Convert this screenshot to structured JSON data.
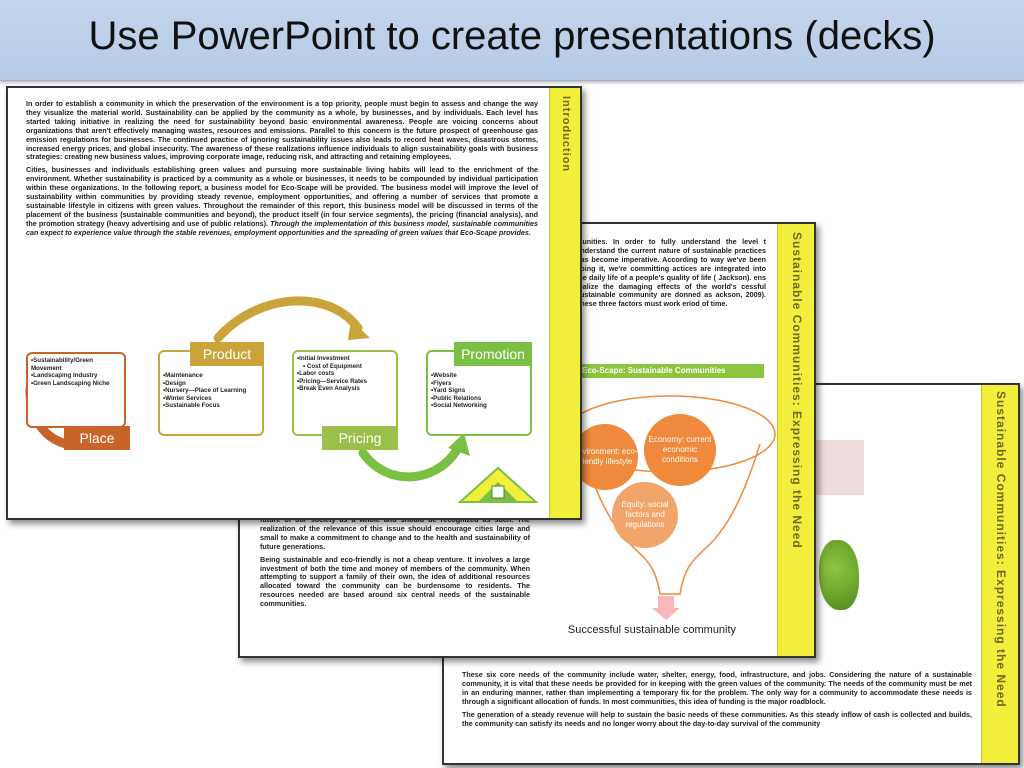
{
  "title": "Use PowerPoint to create presentations (decks)",
  "slide3": {
    "side_title": "Sustainable Communities: Expressing the Need",
    "paragraphs": [
      "These six core needs of the community include water, shelter, energy, food, infrastructure, and jobs. Considering the nature of a sustainable community, it is vital that these needs be provided for in keeping with the green values of the community. The needs of the community must be met in an enduring manner, rather than implementing a temporary fix for the problem. The only way for a community to accommodate these needs is through a significant allocation of funds. In most communities, this idea of funding is the major roadblock.",
      "The generation of a steady revenue will help to sustain the basic needs of these communities. As this steady inflow of cash is collected and builds, the community can satisfy its needs and no longer worry about the day-to-day survival of the community"
    ]
  },
  "slide2": {
    "side_title": "Sustainable Communities: Expressing the Need",
    "top_text": "munities. In order to fully understand the level t understand the current nature of sustainable practices has become imperative. According to way we've been doing it, we're committing actices are integrated into the daily life of a people's quality of life ( Jackson). ens realize the damaging effects of the world's cessful sustainable community are donned as ackson, 2009). These three factors must work eriod of time.",
    "bar_label": "Eco-Scape: Sustainable Communities",
    "circles": {
      "environment": "Environment: eco-friendly lifestyle",
      "economy": "Economy: current economic conditions",
      "equity": "Equity: social factors and regulations"
    },
    "result": "Successful sustainable community",
    "bottom_paragraphs": [
      "future of our society as a whole and should be recognized as such. The realization of the relevance of this issue should encourage cities large and small to make a commitment to change and to the health and sustainability of future generations.",
      "Being sustainable and eco-friendly is not a cheap venture. It involves a large investment of both the time and money of members of the community. When attempting to support a family of their own, the idea of additional resources allocated toward the community can be burdensome to residents. The resources needed are based around six central needs of the sustainable communities."
    ]
  },
  "slide1": {
    "side_title": "Introduction",
    "para1": "In order to establish a community in which the preservation of the environment is a top priority, people must begin to assess and change the way they visualize the material world. Sustainability can be applied by the community as a whole, by businesses, and by individuals. Each level has started taking initiative in realizing the need for sustainability beyond basic environmental awareness. People are voicing concerns about organizations that aren't effectively managing wastes, resources and emissions. Parallel to this concern is the future prospect of greenhouse gas emission regulations for businesses. The continued practice of ignoring sustainability issues also leads to record heat waves, disastrous storms, increased energy prices, and global insecurity. The awareness of these realizations influence individuals to align sustainability goals with business strategies: creating new business values, improving corporate image, reducing risk, and attracting and retaining employees.",
    "para2": "Cities, businesses and individuals establishing green values and pursuing more sustainable living habits will lead to the enrichment of the environment. Whether sustainability is practiced by a community as a whole or businesses, it needs to be compounded by individual participation within these organizations. In the following report, a business model for Eco-Scape will be provided. The business model will improve the level of sustainability within communities by providing steady revenue, employment opportunities, and offering a number of services that promote a sustainable lifestyle in citizens with green values. Throughout the remainder of this report, this business model will be discussed in terms of the placement of the business (sustainable communities and beyond), the product itself (in four service segments), the pricing (financial analysis), and the promotion strategy (heavy advertising and use of public relations).",
    "para2_italic": "Through the implementation of this business model, sustainable communities can expect to experience value through the stable revenues, employment opportunities and the spreading of green values that Eco-Scape provides.",
    "place": {
      "label": "Place",
      "items": [
        "•Sustainability/Green Movement",
        "•Landscaping Industry",
        "•Green Landscaping Niche"
      ]
    },
    "product": {
      "label": "Product",
      "items": [
        "•Maintenance",
        "•Design",
        "•Nursery—Place of Learning",
        "•Winter Services",
        "•Sustainable Focus"
      ]
    },
    "pricing": {
      "label": "Pricing",
      "items": [
        "•Initial Investment",
        "• Cost of Equipment",
        "•Labor costs",
        "•Pricing—Service Rates",
        "•Break Even Analysis"
      ]
    },
    "promotion": {
      "label": "Promotion",
      "items": [
        "•Website",
        "•Flyers",
        "•Yard Signs",
        "•Public Relations",
        "•Social Networking"
      ]
    }
  },
  "colors": {
    "title_bg": "#bccde6",
    "band": "#f2ef3c",
    "place": "#c8642a",
    "product": "#c9a43a",
    "pricing": "#9bc04a",
    "promotion": "#7cbf45",
    "circle_orange": "#ef8a3c"
  }
}
